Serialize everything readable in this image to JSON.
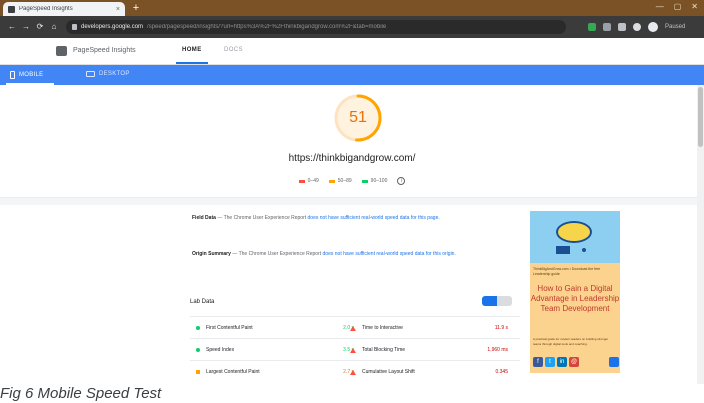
{
  "browser": {
    "tab_title": "PageSpeed Insights",
    "new_tab_symbol": "+",
    "close_symbol": "×",
    "window_controls": [
      "—",
      "▢",
      "✕"
    ],
    "nav": [
      "←",
      "→",
      "⟳",
      "⌂"
    ],
    "url_host": "developers.google.com",
    "url_path": "/speed/pagespeed/insights/?url=https%3A%2F%2Fthinkbigandgrow.com%2F&tab=mobile",
    "profile_status": "Paused"
  },
  "psi": {
    "title": "PageSpeed Insights",
    "tabs": [
      "HOME",
      "DOCS"
    ],
    "device_tabs": [
      "MOBILE",
      "DESKTOP"
    ]
  },
  "score": {
    "value": "51",
    "fraction": 0.51,
    "url": "https://thinkbigandgrow.com/",
    "legend": [
      {
        "label": "0–49",
        "color": "#ff4e42"
      },
      {
        "label": "50–89",
        "color": "#ffa400"
      },
      {
        "label": "90–100",
        "color": "#0cce6b"
      }
    ]
  },
  "report": {
    "field_data_title": "Field Data",
    "field_data_text": "— The Chrome User Experience Report",
    "field_data_link": "does not have sufficient real-world speed data for this page.",
    "origin_title": "Origin Summary",
    "origin_text": "— The Chrome User Experience Report",
    "origin_link": "does not have sufficient real-world speed data for this origin.",
    "lab_data_title": "Lab Data",
    "metrics": [
      {
        "left_name": "First Contentful Paint",
        "left_value": "2.0 s",
        "left_status": "green",
        "right_name": "Time to Interactive",
        "right_value": "11.9 s",
        "right_status": "red"
      },
      {
        "left_name": "Speed Index",
        "left_value": "3.5 s",
        "left_status": "green",
        "right_name": "Total Blocking Time",
        "right_value": "1,960 ms",
        "right_status": "red"
      },
      {
        "left_name": "Largest Contentful Paint",
        "left_value": "2.7 s",
        "left_status": "orange",
        "right_name": "Cumulative Layout Shift",
        "right_value": "0.345",
        "right_status": "red"
      }
    ]
  },
  "ad": {
    "small_text": "ThinkBigAndGrow.com • Download the free Leadership guide",
    "headline": "How to Gain a Digital Advantage in Leadership Team Development",
    "foot_text": "A practical guide for modern leaders on building stronger teams through digital tools and coaching.",
    "social": [
      {
        "icon": "facebook-icon",
        "glyph": "f",
        "color": "#3b5998"
      },
      {
        "icon": "twitter-icon",
        "glyph": "t",
        "color": "#1da1f2"
      },
      {
        "icon": "linkedin-icon",
        "glyph": "in",
        "color": "#0077b5"
      },
      {
        "icon": "email-icon",
        "glyph": "@",
        "color": "#d44638"
      }
    ]
  },
  "caption": "Fig 6 Mobile Speed Test"
}
